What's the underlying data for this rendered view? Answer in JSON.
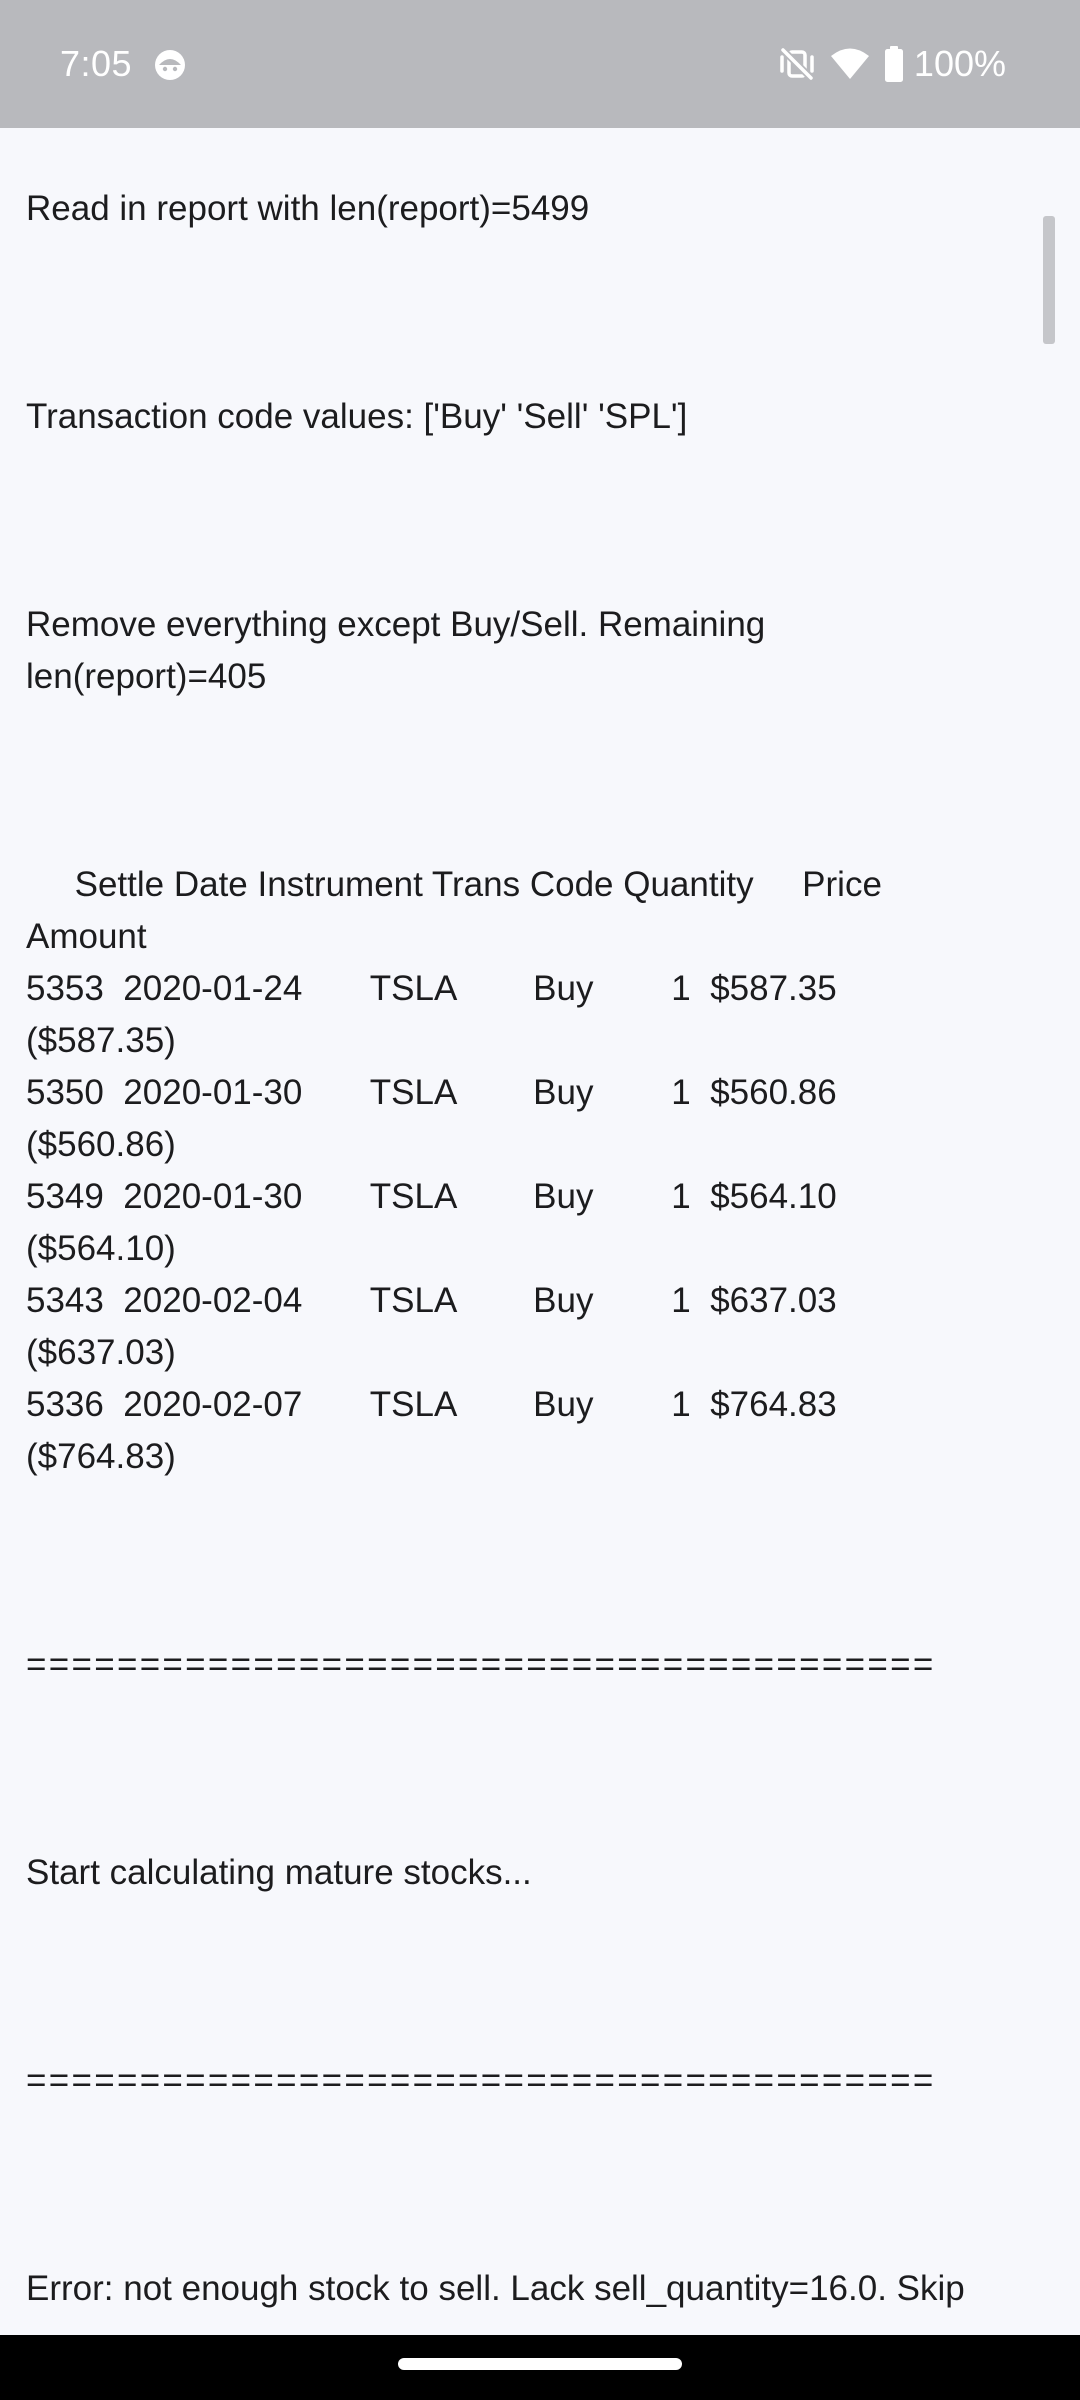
{
  "status_bar": {
    "time": "7:05",
    "battery": "100%",
    "icons": [
      "face-notification-icon",
      "vibrate-off-icon",
      "wifi-icon",
      "battery-icon"
    ]
  },
  "colors": {
    "status_bar_bg": "#b8b9bd",
    "page_bg": "#f7f8fc",
    "text": "#1c1c1e",
    "nav_bar_bg": "#000000"
  },
  "log": {
    "read_report": "Read in report with len(report)=5499",
    "transaction_codes": "Transaction code values: ['Buy' 'Sell' 'SPL']",
    "remove_line_1": "Remove everything except Buy/Sell. Remaining",
    "remove_line_2": "len(report)=405",
    "table_header_1": "     Settle Date Instrument Trans Code Quantity     Price",
    "table_header_2": "Amount",
    "rows": [
      {
        "line": "5353  2020-01-24       TSLA        Buy        1  $587.35",
        "amount": "($587.35)"
      },
      {
        "line": "5350  2020-01-30       TSLA        Buy        1  $560.86",
        "amount": "($560.86)"
      },
      {
        "line": "5349  2020-01-30       TSLA        Buy        1  $564.10",
        "amount": "($564.10)"
      },
      {
        "line": "5343  2020-02-04       TSLA        Buy        1  $637.03",
        "amount": "($637.03)"
      },
      {
        "line": "5336  2020-02-07       TSLA        Buy        1  $764.83",
        "amount": "($764.83)"
      }
    ],
    "separator_1": "========================================",
    "start_calculating": "Start calculating mature stocks...",
    "separator_2": "========================================",
    "error": "Error: not enough stock to sell. Lack sell_quantity=16.0. Skip"
  }
}
